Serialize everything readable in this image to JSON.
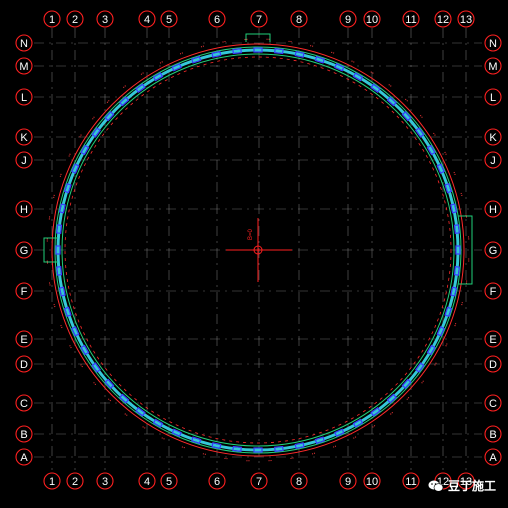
{
  "grid": {
    "columns": [
      "1",
      "2",
      "3",
      "4",
      "5",
      "6",
      "7",
      "8",
      "9",
      "10",
      "11",
      "12",
      "13"
    ],
    "rows": [
      "N",
      "M",
      "L",
      "K",
      "J",
      "H",
      "G",
      "F",
      "E",
      "D",
      "C",
      "B",
      "A"
    ]
  },
  "origin_label": "B=0",
  "colors": {
    "background": "#000000",
    "bubble": "#ff2020",
    "gridline": "#b0b0b0",
    "outer_ring": "#ff2a2a",
    "ring_green": "#21d07a",
    "ring_cyan": "#35c8d8",
    "piles": "#3a3aff",
    "dashes": "#ff3a3a",
    "axes_marker": "#ff2020"
  },
  "watermark": {
    "text": "豆丁施工",
    "icon": "wechat-logo-icon"
  }
}
